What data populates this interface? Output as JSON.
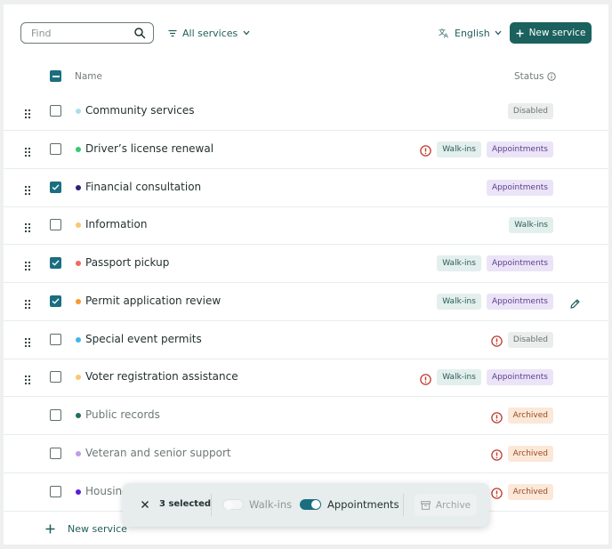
{
  "toolbar": {
    "search_placeholder": "Find",
    "filter_label": "All services",
    "language_label": "English",
    "new_service_label": "New service"
  },
  "table": {
    "col_name": "Name",
    "col_status": "Status"
  },
  "tags": {
    "walkins": "Walk-ins",
    "appointments": "Appointments",
    "disabled": "Disabled",
    "archived": "Archived"
  },
  "colors": {
    "accent": "#1b615e",
    "checkbox": "#1b6e80",
    "warning": "#c0392b"
  },
  "services": [
    {
      "name": "Community services",
      "dot": "#a9e0ea",
      "checked": false,
      "warn": false,
      "walkins": false,
      "appointments": false,
      "disabled": true,
      "archived": false,
      "draggable": true
    },
    {
      "name": "Driver’s license renewal",
      "dot": "#2ecc71",
      "checked": false,
      "warn": true,
      "walkins": true,
      "appointments": true,
      "disabled": false,
      "archived": false,
      "draggable": true
    },
    {
      "name": "Financial consultation",
      "dot": "#2c2377",
      "checked": true,
      "warn": false,
      "walkins": false,
      "appointments": true,
      "disabled": false,
      "archived": false,
      "draggable": true
    },
    {
      "name": "Information",
      "dot": "#f7c873",
      "checked": false,
      "warn": false,
      "walkins": true,
      "appointments": false,
      "disabled": false,
      "archived": false,
      "draggable": true
    },
    {
      "name": "Passport pickup",
      "dot": "#f26863",
      "checked": true,
      "warn": false,
      "walkins": true,
      "appointments": true,
      "disabled": false,
      "archived": false,
      "draggable": true
    },
    {
      "name": "Permit application review",
      "dot": "#f79a2a",
      "checked": true,
      "warn": false,
      "walkins": true,
      "appointments": true,
      "disabled": false,
      "archived": false,
      "draggable": true,
      "editable": true
    },
    {
      "name": "Special event permits",
      "dot": "#40b6ea",
      "checked": false,
      "warn": true,
      "walkins": false,
      "appointments": false,
      "disabled": true,
      "archived": false,
      "draggable": true
    },
    {
      "name": "Voter registration assistance",
      "dot": "#f7c873",
      "checked": false,
      "warn": true,
      "walkins": true,
      "appointments": true,
      "disabled": false,
      "archived": false,
      "draggable": true
    },
    {
      "name": "Public records",
      "dot": "#1e6e63",
      "checked": false,
      "warn": true,
      "walkins": false,
      "appointments": false,
      "disabled": false,
      "archived": true,
      "draggable": false
    },
    {
      "name": "Veteran and senior support",
      "dot": "#c39be6",
      "checked": false,
      "warn": true,
      "walkins": false,
      "appointments": false,
      "disabled": false,
      "archived": true,
      "draggable": false
    },
    {
      "name": "Housing",
      "dot": "#5b1ed1",
      "checked": false,
      "warn": true,
      "walkins": false,
      "appointments": false,
      "disabled": false,
      "archived": true,
      "draggable": false
    }
  ],
  "footer": {
    "new_service_label": "New service"
  },
  "bulk": {
    "selected_label": "3 selected",
    "walkins_label": "Walk-ins",
    "walkins_on": false,
    "appointments_label": "Appointments",
    "appointments_on": true,
    "archive_label": "Archive"
  }
}
